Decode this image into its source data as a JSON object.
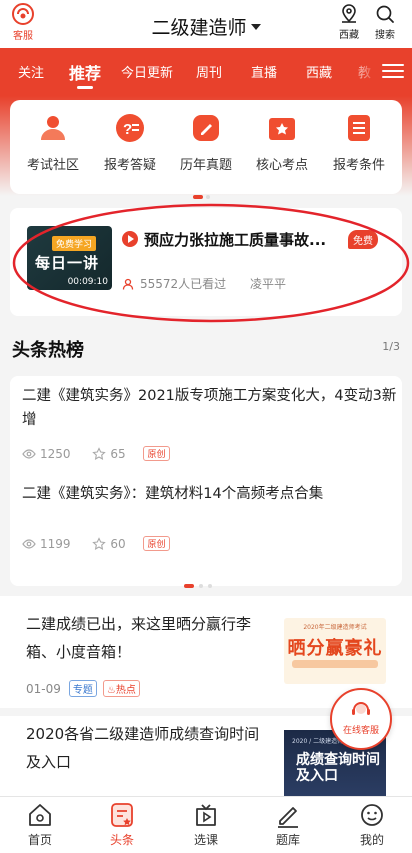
{
  "header": {
    "service_label": "客服",
    "title": "二级建造师",
    "region_label": "西藏",
    "search_label": "搜索"
  },
  "tabs": [
    {
      "label": "关注"
    },
    {
      "label": "推荐",
      "active": true
    },
    {
      "label": "今日更新"
    },
    {
      "label": "周刊"
    },
    {
      "label": "直播"
    },
    {
      "label": "西藏"
    },
    {
      "label": "教"
    }
  ],
  "quick_nav": [
    {
      "label": "考试社区",
      "icon": "community-icon"
    },
    {
      "label": "报考答疑",
      "icon": "qa-icon"
    },
    {
      "label": "历年真题",
      "icon": "past-papers-icon"
    },
    {
      "label": "核心考点",
      "icon": "key-points-icon"
    },
    {
      "label": "报考条件",
      "icon": "conditions-icon"
    }
  ],
  "lesson": {
    "thumb_badge": "免费学习",
    "thumb_title": "每日一讲",
    "duration": "00:09:10",
    "title": "预应力张拉施工质量事故...",
    "free_badge": "免费",
    "viewers": "55572人已看过",
    "teacher": "凌平平"
  },
  "headlines": {
    "title": "头条热榜",
    "pager": "1/3",
    "items": [
      {
        "title": "二建《建筑实务》2021版专项施工方案变化大，4变动3新增",
        "views": "1250",
        "stars": "65",
        "tag": "原创"
      },
      {
        "title": "二建《建筑实务》：建筑材料14个高频考点合集",
        "views": "1199",
        "stars": "60",
        "tag": "原创"
      }
    ]
  },
  "feed": [
    {
      "title": "二建成绩已出，来这里晒分赢行李箱、小度音箱！",
      "date": "01-09",
      "topic_tag": "专题",
      "hot_tag": "热点",
      "image_small_text": "2020年二级建造师考试",
      "image_big_text": "晒分赢豪礼"
    },
    {
      "title": "2020各省二级建造师成绩查询时间及入口",
      "image_small_text": "2020 / 二级建造师考试",
      "image_big_text": "成绩查询时间及入口"
    }
  ],
  "float_service_label": "在线客服",
  "bottom_nav": [
    {
      "label": "首页"
    },
    {
      "label": "头条",
      "active": true
    },
    {
      "label": "选课"
    },
    {
      "label": "题库"
    },
    {
      "label": "我的"
    }
  ],
  "colors": {
    "brand_red": "#e8412c",
    "topic_blue": "#3b79cf"
  }
}
